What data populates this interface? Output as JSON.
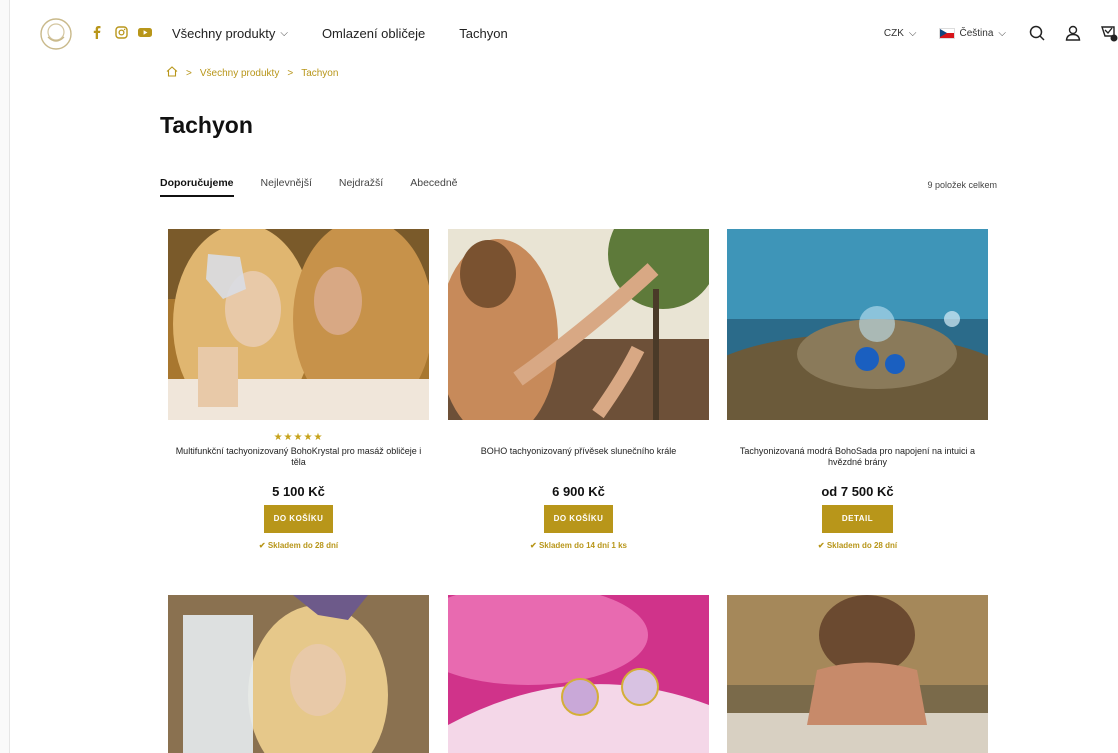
{
  "header": {
    "nav": [
      {
        "label": "Všechny produkty",
        "has_dropdown": true
      },
      {
        "label": "Omlazení obličeje",
        "has_dropdown": false
      },
      {
        "label": "Tachyon",
        "has_dropdown": false
      }
    ],
    "currency": "CZK",
    "language": "Čeština",
    "social_icons": [
      "facebook-icon",
      "instagram-icon",
      "youtube-icon"
    ],
    "accent_color": "#b8961a"
  },
  "breadcrumb": [
    "Všechny produkty",
    "Tachyon"
  ],
  "page_title": "Tachyon",
  "sort_tabs": [
    "Doporučujeme",
    "Nejlevnější",
    "Nejdražší",
    "Abecedně"
  ],
  "active_sort": "Doporučujeme",
  "item_count": "9 položek celkem",
  "products": [
    {
      "stars": "★★★★★",
      "name": "Multifunkční tachyonizovaný BohoKrystal pro masáž obličeje i těla",
      "price": "5 100 Kč",
      "button": "DO KOŠÍKU",
      "stock": "✔ Skladem do 28 dní"
    },
    {
      "stars": "",
      "name": "BOHO tachyonizovaný přívěsek slunečního krále",
      "price": "6 900 Kč",
      "button": "DO KOŠÍKU",
      "stock": "✔ Skladem do 14 dní 1 ks"
    },
    {
      "stars": "",
      "name": "Tachyonizovaná modrá BohoSada pro napojení na intuici a hvězdné brány",
      "price": "od 7 500 Kč",
      "button": "DETAIL",
      "stock": "✔ Skladem do 28 dní"
    }
  ]
}
